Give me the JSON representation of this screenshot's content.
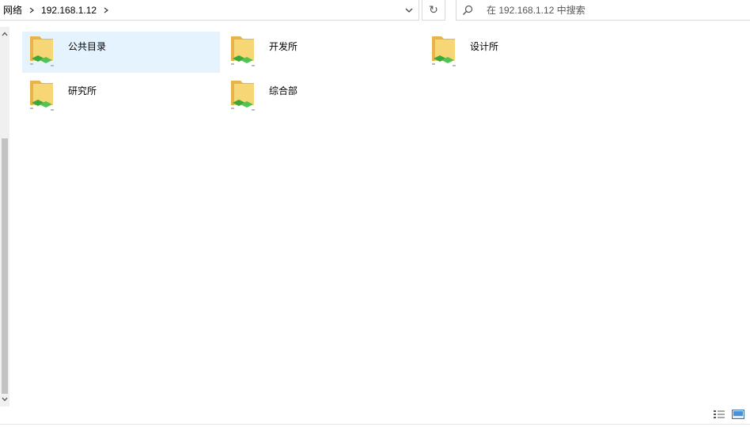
{
  "address_bar": {
    "breadcrumbs": [
      "网络",
      "192.168.1.12"
    ],
    "refresh_icon": "↻"
  },
  "search": {
    "placeholder": "在 192.168.1.12 中搜索"
  },
  "folders": [
    {
      "label": "公共目录",
      "selected": true,
      "icon": "shared-folder-icon"
    },
    {
      "label": "开发所",
      "selected": false,
      "icon": "shared-folder-icon"
    },
    {
      "label": "设计所",
      "selected": false,
      "icon": "shared-folder-icon"
    },
    {
      "label": "研究所",
      "selected": false,
      "icon": "shared-folder-icon"
    },
    {
      "label": "综合部",
      "selected": false,
      "icon": "shared-folder-icon"
    }
  ],
  "colors": {
    "selection": "#e5f3ff",
    "folder_yellow": "#f5cc5c",
    "network_green": "#3aa83a"
  }
}
